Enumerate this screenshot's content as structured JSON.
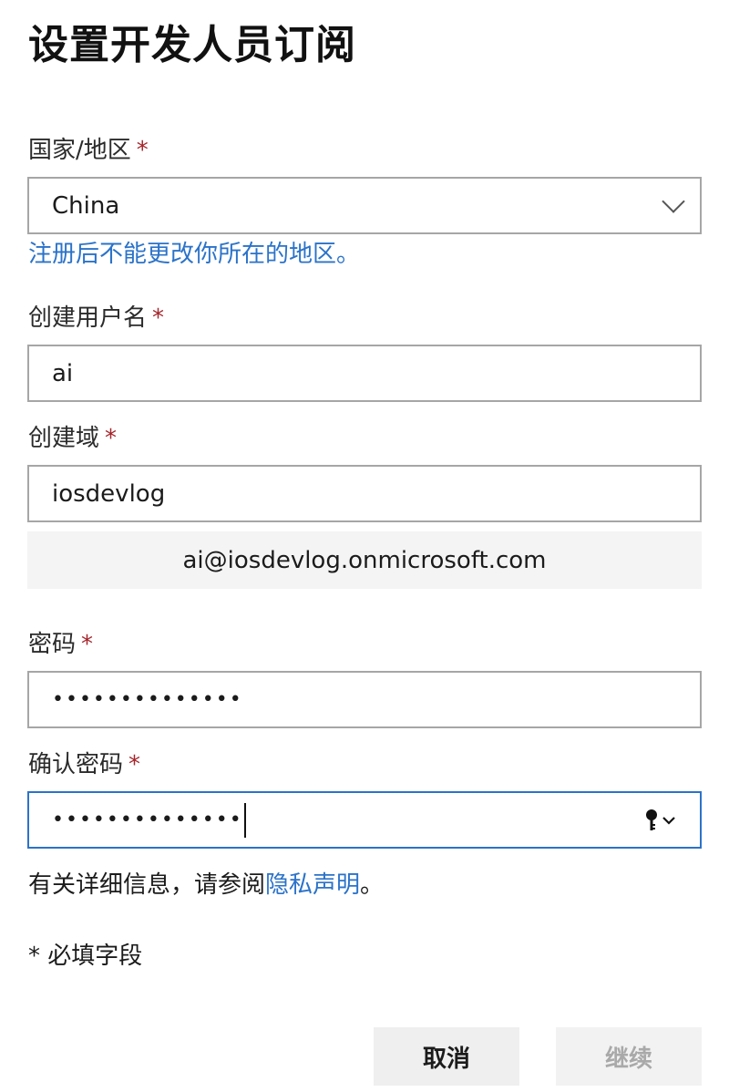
{
  "page": {
    "title": "设置开发人员订阅"
  },
  "form": {
    "country": {
      "label": "国家/地区",
      "required_mark": "*",
      "value": "China",
      "hint": "注册后不能更改你所在的地区。"
    },
    "username": {
      "label": "创建用户名",
      "required_mark": "*",
      "value": "ai"
    },
    "domain": {
      "label": "创建域",
      "required_mark": "*",
      "value": "iosdevlog",
      "preview_email": "ai@iosdevlog.onmicrosoft.com"
    },
    "password": {
      "label": "密码",
      "required_mark": "*",
      "masked_value": "••••••••••••••"
    },
    "confirm_password": {
      "label": "确认密码",
      "required_mark": "*",
      "masked_value": "••••••••••••••",
      "focused": true
    }
  },
  "info": {
    "text_before": "有关详细信息，请参阅",
    "link": "隐私声明",
    "text_after": "。"
  },
  "required_note": "* 必填字段",
  "buttons": {
    "cancel_label": "取消",
    "continue_label": "继续",
    "continue_disabled": true
  },
  "colors": {
    "accent": "#2b73c9",
    "required": "#a4262c",
    "border": "#a6a6a6"
  },
  "icons": {
    "select": "chevron-down-icon",
    "password_reveal": "key-icon"
  }
}
